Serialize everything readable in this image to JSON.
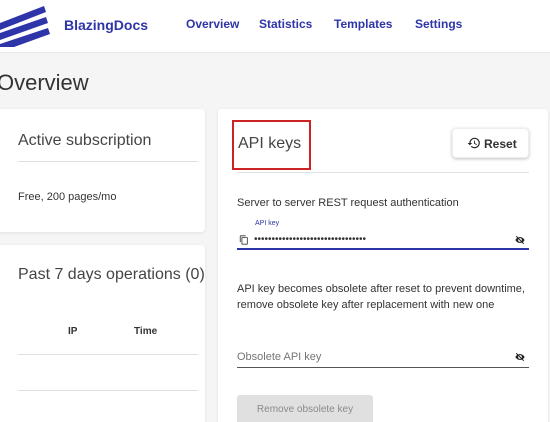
{
  "brand": {
    "name": "BlazingDocs"
  },
  "nav": [
    {
      "label": "Overview"
    },
    {
      "label": "Statistics"
    },
    {
      "label": "Templates"
    },
    {
      "label": "Settings"
    }
  ],
  "page": {
    "title": "Overview"
  },
  "subscription": {
    "title": "Active subscription",
    "plan": "Free, 200 pages/mo"
  },
  "operations": {
    "title": "Past 7 days operations (0)",
    "columns": [
      "IP",
      "Time"
    ]
  },
  "api_keys": {
    "title": "API keys",
    "reset_label": "Reset",
    "auth_description": "Server to server REST request authentication",
    "api_key_label": "API key",
    "api_key_value": "••••••••••••••••••••••••••••••••",
    "obsolete_description": "API key becomes obsolete after reset to prevent downtime, remove obsolete key after replacement with new one",
    "obsolete_placeholder": "Obsolete API key",
    "remove_label": "Remove obsolete key"
  },
  "colors": {
    "brand": "#2e35a8",
    "highlight": "#cc2222"
  },
  "icons": [
    "logo-icon",
    "history-icon",
    "copy-icon",
    "eye-off-icon"
  ]
}
